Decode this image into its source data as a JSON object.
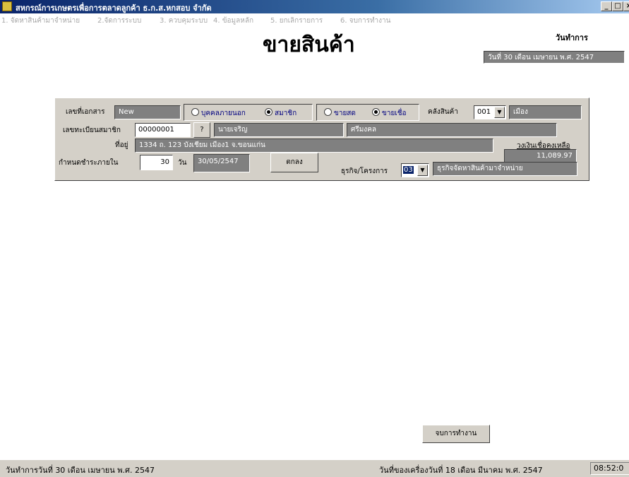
{
  "window": {
    "title": "สหกรณ์การเกษตรเพื่อการตลาดลูกค้า ธ.ก.ส.หกสอบ จำกัด",
    "minimize": "_",
    "maximize": "□"
  },
  "menu": [
    "1. จัดหาสินค้ามาจำหน่าย",
    "2.จัดการระบบ",
    "3. ควบคุมระบบ",
    "4. ข้อมูลหลัก",
    "5. ยกเลิกรายการ",
    "6. จบการทำงาน"
  ],
  "header": {
    "heading": "ขายสินค้า",
    "date_caption": "วันทำการ",
    "date_value": "วันที่ 30 เดือน เมษายน  พ.ศ. 2547"
  },
  "form": {
    "doc_no_label": "เลขที่เอกสาร",
    "doc_no_value": "New",
    "customer_type": {
      "outsider_label": "บุคคลภายนอก",
      "member_label": "สมาชิก",
      "selected": "member"
    },
    "sale_type": {
      "cash_label": "ขายสด",
      "credit_label": "ขายเชื่อ",
      "selected": "credit"
    },
    "warehouse_label": "คลังสินค้า",
    "warehouse_code": "001",
    "warehouse_name": "เมือง",
    "member_no_label": "เลขทะเบียนสมาชิก",
    "member_no_value": "00000001",
    "lookup_button": "?",
    "first_name": "นายเจริญ",
    "last_name": "ศรีมงคล",
    "address_label": "ที่อยู่",
    "address_value": "1334 ถ. 123 บังเชียม เมือง1 จ.ขอนแก่น",
    "credit_remaining_label": "วงเงินเชื่อคงเหลือ",
    "credit_remaining_value": "11,089.97",
    "due_label": "กำหนดชำระภายใน",
    "due_days": "30",
    "days_unit": "วัน",
    "due_date": "30/05/2547",
    "ok_button": "ตกลง",
    "business_label": "ธุรกิจ/โครงการ",
    "business_code": "03",
    "business_name": "ธุรกิจจัดหาสินค้ามาจำหน่าย"
  },
  "finish_button": "จบการทำงาน",
  "status": {
    "work_date": "วันทำการวันที่ 30 เดือน เมษายน  พ.ศ. 2547",
    "machine_date": "วันที่ของเครื่องวันที่ 18 เดือน มีนาคม  พ.ศ. 2547",
    "time": "08:52:0"
  }
}
